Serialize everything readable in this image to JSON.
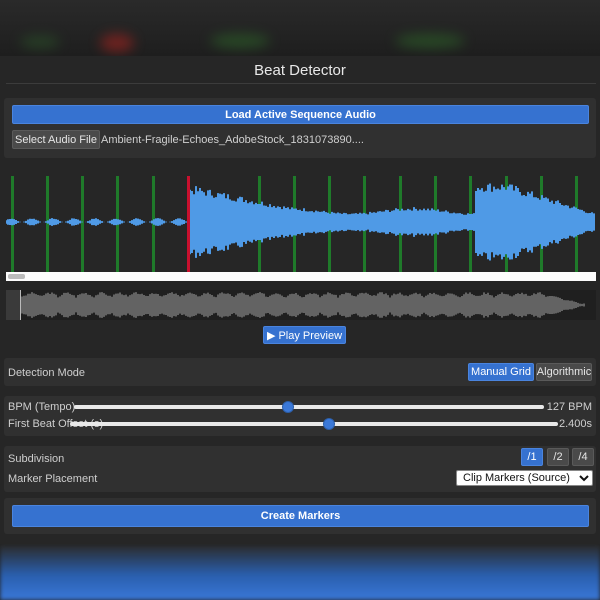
{
  "app": {
    "title": "Beat Detector"
  },
  "load": {
    "load_button": "Load Active Sequence Audio",
    "select_button": "Select Audio File",
    "file_name": "Ambient-Fragile-Echoes_AdobeStock_1831073890...."
  },
  "preview": {
    "play_button": "▶ Play Preview"
  },
  "detection": {
    "label": "Detection Mode",
    "modes": [
      "Manual Grid",
      "Algorithmic"
    ],
    "active_mode": "Manual Grid"
  },
  "tempo": {
    "bpm_label": "BPM (Tempo)",
    "bpm_value_text": "127 BPM",
    "bpm_fraction": 0.455,
    "offset_label": "First Beat Offset (s)",
    "offset_value_text": "2.400s",
    "offset_fraction": 0.53
  },
  "placement": {
    "subdivision_label": "Subdivision",
    "subdivisions": [
      "/1",
      "/2",
      "/4"
    ],
    "active_subdivision": "/1",
    "marker_label": "Marker Placement",
    "marker_selected": "Clip Markers (Source)"
  },
  "create": {
    "button": "Create Markers"
  },
  "colors": {
    "accent": "#3672d0",
    "waveform": "#4f9ae6",
    "beat_marker": "#1f7a2a",
    "playhead": "#c8102e"
  }
}
